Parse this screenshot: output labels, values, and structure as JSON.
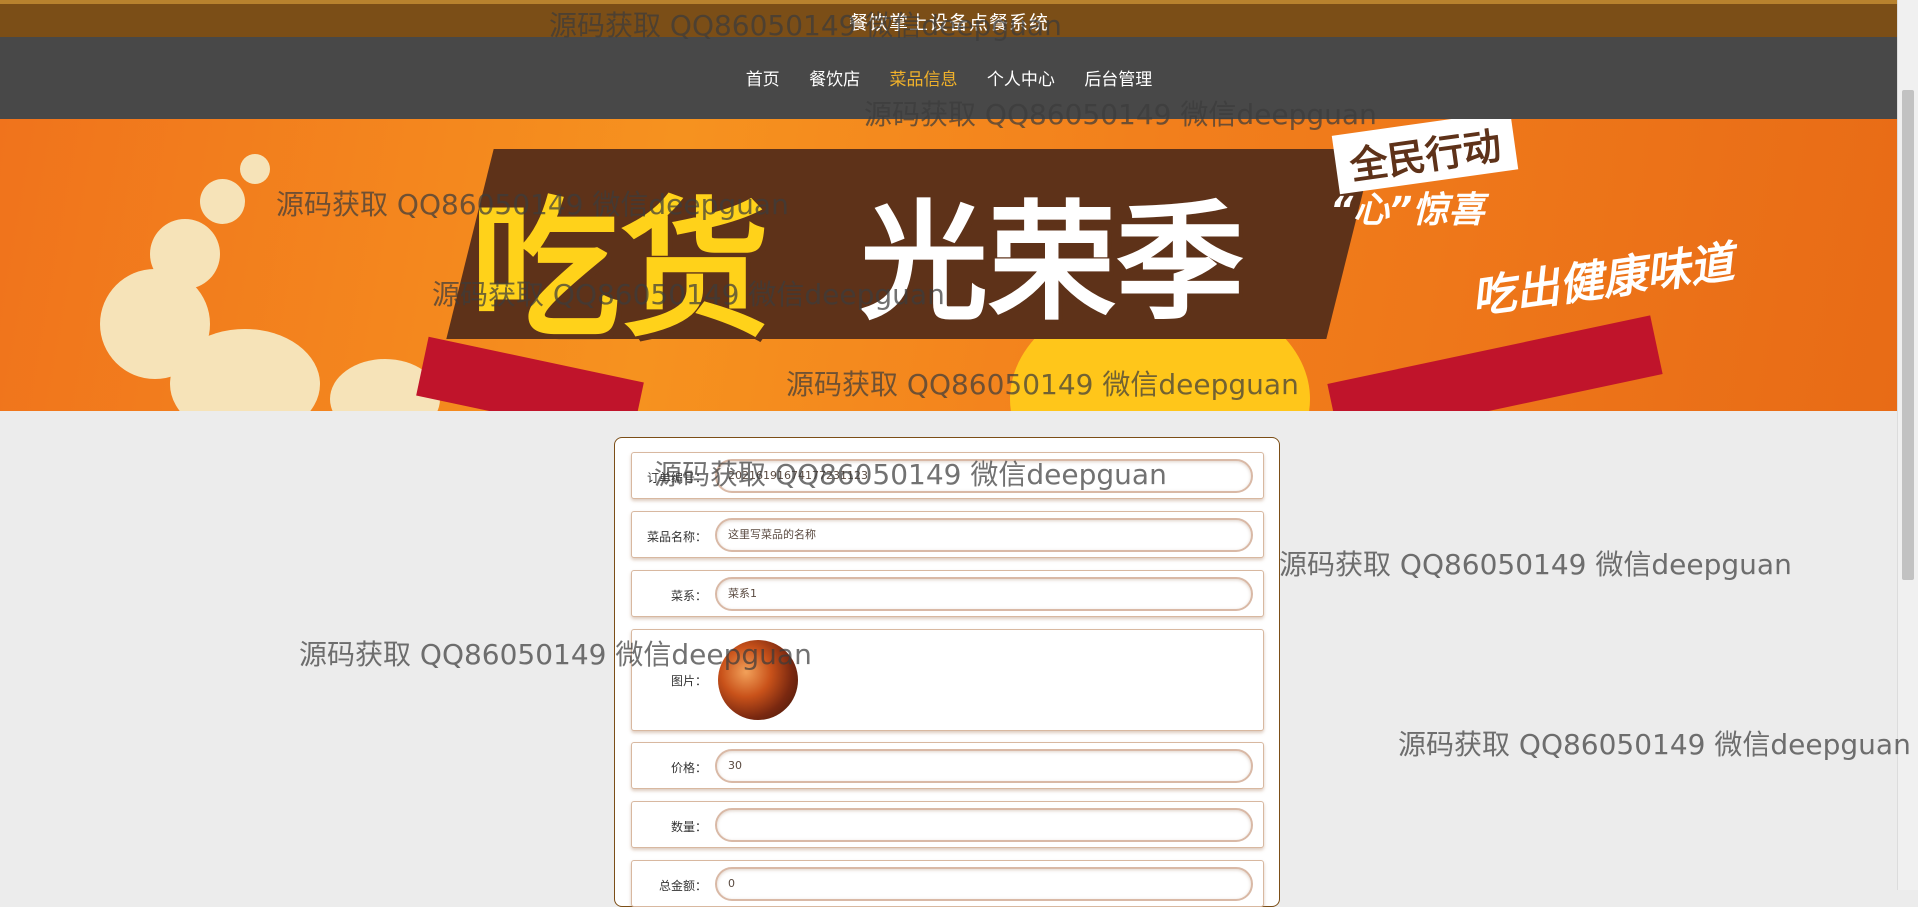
{
  "header": {
    "title": "餐饮掌上设备点餐系统"
  },
  "nav": {
    "items": [
      "首页",
      "餐饮店",
      "菜品信息",
      "个人中心",
      "后台管理"
    ],
    "active_index": 2
  },
  "banner": {
    "headline_left": "吃货",
    "headline_main": "光荣季",
    "tagline_top": "全民行动",
    "tagline_mid": "“心”惊喜",
    "tagline_right": "吃出健康味道"
  },
  "form": {
    "order_no": {
      "label": "订单编号：",
      "value": "20216191674177231123"
    },
    "dish_name": {
      "label": "菜品名称：",
      "value": "这里写菜品的名称"
    },
    "cuisine": {
      "label": "菜系：",
      "value": "菜系1"
    },
    "image": {
      "label": "图片："
    },
    "price": {
      "label": "价格：",
      "value": "30"
    },
    "quantity": {
      "label": "数量：",
      "value": ""
    },
    "total": {
      "label": "总金额：",
      "value": "0"
    }
  },
  "watermark": {
    "text": "源码获取 QQ86050149 微信deepguan"
  },
  "colors": {
    "topbar": "#7b4e17",
    "navbar": "#484848",
    "active_nav": "#f0b12a",
    "banner": "#f0731c"
  }
}
